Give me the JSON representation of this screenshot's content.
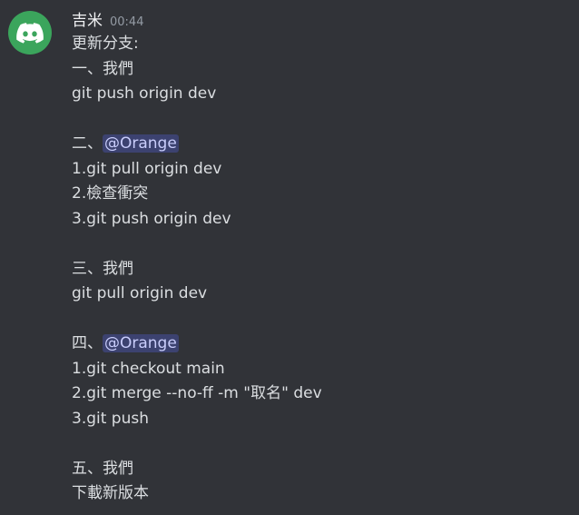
{
  "message": {
    "username": "吉米",
    "timestamp": "00:44",
    "avatar_icon": "discord-logo-icon",
    "avatar_color": "#3ba55c",
    "mention_color": "#3c4270",
    "lines": {
      "l1": "更新分支:",
      "l2": "一、我們",
      "l3": "git push origin dev",
      "l5_prefix": "二、",
      "l5_mention": "@Orange",
      "l6": "1.git pull origin dev",
      "l7": "2.檢查衝突",
      "l8": "3.git push origin dev",
      "l10": "三、我們",
      "l11": "git pull origin dev",
      "l13_prefix": "四、",
      "l13_mention": "@Orange",
      "l14": "1.git checkout main",
      "l15": "2.git merge --no-ff -m \"取名\" dev",
      "l16": "3.git push",
      "l18": "五、我們",
      "l19": "下載新版本"
    }
  }
}
